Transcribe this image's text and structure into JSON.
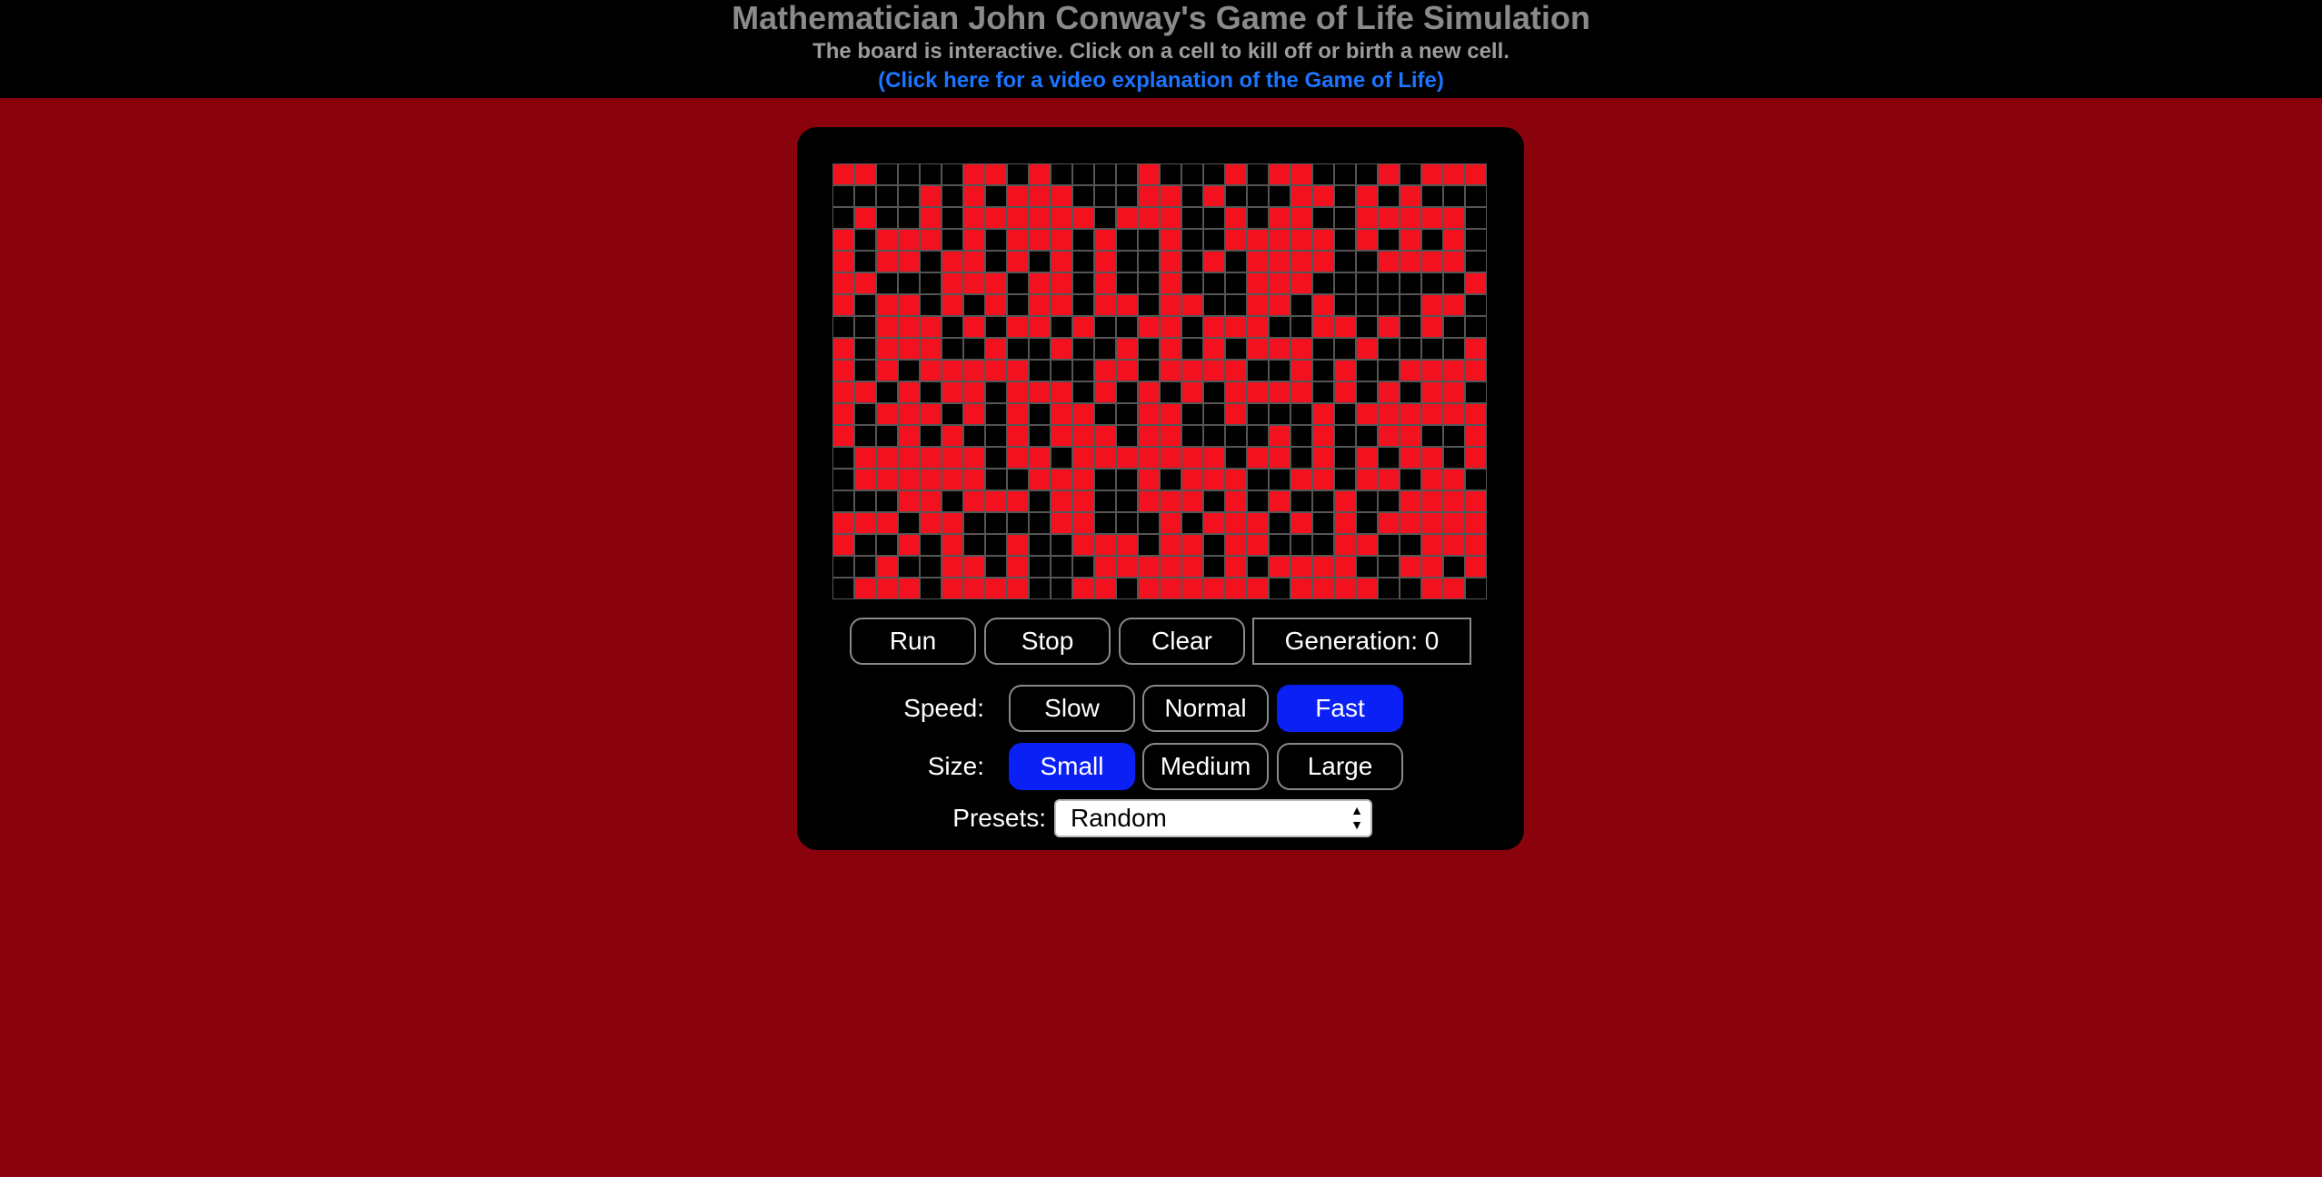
{
  "header": {
    "title": "Mathematician John Conway's Game of Life Simulation",
    "subtitle": "The board is interactive. Click on a cell to kill off or birth a new cell.",
    "video_link": "(Click here for a video explanation of the Game of Life)"
  },
  "board": {
    "columns": 30,
    "rows": 20,
    "alive_color": "#f4111f",
    "dead_color": "#000000",
    "grid": [
      "110000110100001000101100010111",
      "000010101110001101000110101000",
      "010010111111011100101100111110",
      "101110101110100100111110101010",
      "101101101010100101011110011110",
      "110001110110100100011100000001",
      "101101010110110110011010000110",
      "001110101101001101110011010100",
      "101110010010010101011100100001",
      "101011111000110111100101001111",
      "110101101110101010111101010110",
      "101110101011001100100010111111",
      "100101001011101100001010011001",
      "011111101101111111011010101101",
      "011111100111001011100110110110",
      "000110111011001110101001001111",
      "111011000011000101110101011111",
      "100101001001110110110001100111",
      "001001101000111110101111001101",
      "011101111001101111110111100110"
    ]
  },
  "controls": {
    "run": "Run",
    "stop": "Stop",
    "clear": "Clear",
    "generation_label": "Generation: 0",
    "speed_label": "Speed:",
    "speed_options": [
      "Slow",
      "Normal",
      "Fast"
    ],
    "speed_selected": "Fast",
    "size_label": "Size:",
    "size_options": [
      "Small",
      "Medium",
      "Large"
    ],
    "size_selected": "Small",
    "presets_label": "Presets:",
    "presets_value": "Random",
    "active_button_color": "#0a20f5"
  }
}
